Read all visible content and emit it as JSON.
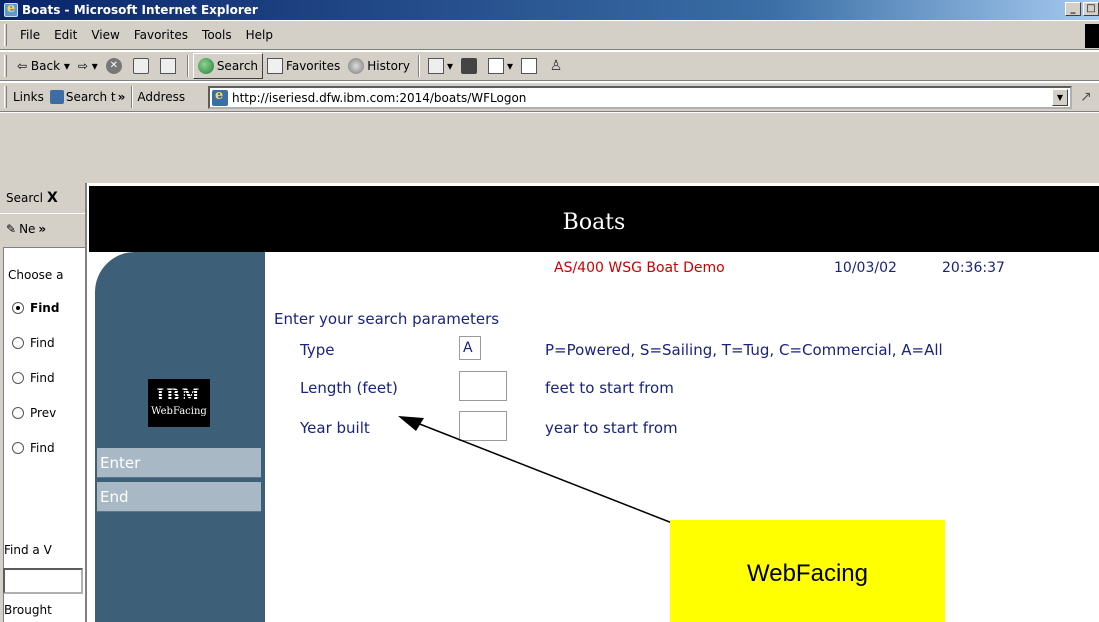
{
  "window": {
    "title": "Boats - Microsoft Internet Explorer"
  },
  "menu": [
    "File",
    "Edit",
    "View",
    "Favorites",
    "Tools",
    "Help"
  ],
  "toolbar": {
    "back": "Back",
    "search": "Search",
    "favorites": "Favorites",
    "history": "History"
  },
  "addressbar": {
    "links_label": "Links",
    "links_item": "Search t",
    "links_more": "»",
    "address_label": "Address",
    "url": "http://iseriesd.dfw.ibm.com:2014/boats/WFLogon"
  },
  "search_pane": {
    "title": "Searcl",
    "close": "X",
    "new_label": "Ne",
    "new_more": "»",
    "choose": "Choose a",
    "options": [
      {
        "label": "Find",
        "selected": true
      },
      {
        "label": "Find",
        "selected": false
      },
      {
        "label": "Find",
        "selected": false
      },
      {
        "label": "Prev",
        "selected": false
      },
      {
        "label": "Find",
        "selected": false
      }
    ],
    "find_label": "Find a V",
    "brought": "Brought"
  },
  "app": {
    "title": "Boats",
    "demo_name": "AS/400 WSG Boat Demo",
    "date": "10/03/02",
    "time": "20:36:37",
    "logo_text": "IBM",
    "logo_subtext": "WebFacing",
    "buttons": [
      "Enter",
      "End"
    ],
    "prompt": "Enter your search parameters",
    "fields": [
      {
        "label": "Type",
        "value": "A",
        "hint": "P=Powered, S=Sailing, T=Tug, C=Commercial, A=All"
      },
      {
        "label": "Length (feet)",
        "value": "",
        "hint": "feet to start from"
      },
      {
        "label": "Year built",
        "value": "",
        "hint": "year to start from"
      }
    ]
  },
  "callout": {
    "text": "WebFacing",
    "color": "#ffff00"
  },
  "colors": {
    "header_red": "#c00000",
    "side_panel": "#3e5f78",
    "form_text": "#1a237e",
    "status_red": "#cc0000"
  }
}
